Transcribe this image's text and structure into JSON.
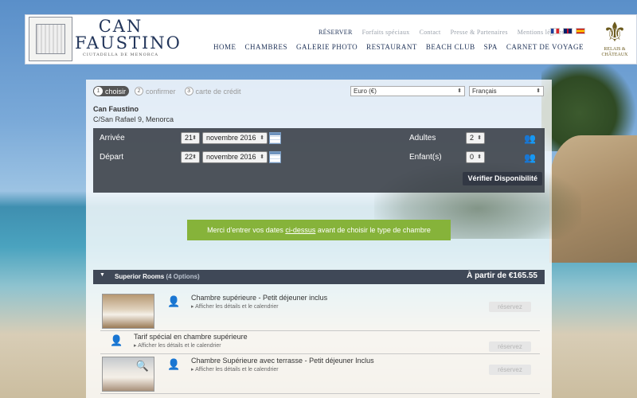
{
  "header": {
    "logo": {
      "name_line1": "CAN",
      "name_line2": "FAUSTINO",
      "subtitle": "CIUTADELLA DE MENORCA"
    },
    "top_links": [
      "RÉSERVER",
      "Forfaits spéciaux",
      "Contact",
      "Presse & Partenaires",
      "Mentions légales"
    ],
    "main_nav": [
      "HOME",
      "CHAMBRES",
      "GALERIE PHOTO",
      "RESTAURANT",
      "BEACH CLUB",
      "SPA",
      "CARNET DE VOYAGE"
    ],
    "partner_logo": {
      "line1": "RELAIS &",
      "line2": "CHÂTEAUX"
    }
  },
  "booking": {
    "steps": [
      {
        "num": "1",
        "label": "choisir"
      },
      {
        "num": "2",
        "label": "confirmer"
      },
      {
        "num": "3",
        "label": "carte de crédit"
      }
    ],
    "currency_select": "Euro (€)",
    "language_select": "Français",
    "hotel_name": "Can Faustino",
    "hotel_address": "C/San Rafael 9, Menorca",
    "arrival_label": "Arrivée",
    "arrival_day": "21",
    "arrival_month": "novembre 2016",
    "departure_label": "Départ",
    "departure_day": "22",
    "departure_month": "novembre 2016",
    "adults_label": "Adultes",
    "adults_value": "2",
    "children_label": "Enfant(s)",
    "children_value": "0",
    "verify_button": "Vérifier Disponibilité",
    "notice_before": "Merci d'entrer vos dates ",
    "notice_link": "ci-dessus",
    "notice_after": " avant de choisir le type de chambre"
  },
  "rooms": {
    "section_title": "Superior Rooms",
    "section_options": "(4 Options)",
    "price_label": "À partir de €165.55",
    "items": [
      {
        "name": "Chambre supérieure - Petit déjeuner inclus",
        "link": "Afficher les détails et le calendrier",
        "button": "réservez"
      },
      {
        "name": "Tarif spécial en chambre supérieure",
        "link": "Afficher les détails et le calendrier",
        "button": "réservez"
      },
      {
        "name": "Chambre Supérieure avec terrasse - Petit déjeuner Inclus",
        "link": "Afficher les détails et le calendrier",
        "button": "réservez"
      }
    ]
  }
}
